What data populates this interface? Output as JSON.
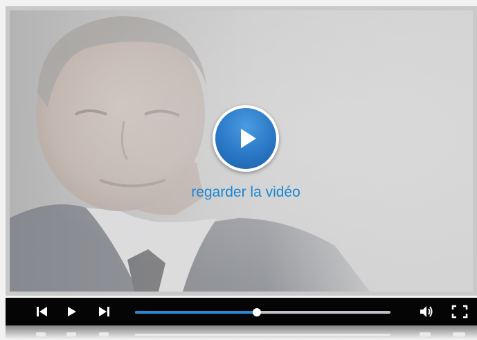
{
  "player": {
    "watch_label": "regarder la vidéo",
    "progress_fraction": 0.478,
    "accent_color": "#2d87d8",
    "icons": [
      "skip-previous-icon",
      "play-icon",
      "skip-next-icon",
      "volume-icon",
      "fullscreen-icon"
    ]
  }
}
